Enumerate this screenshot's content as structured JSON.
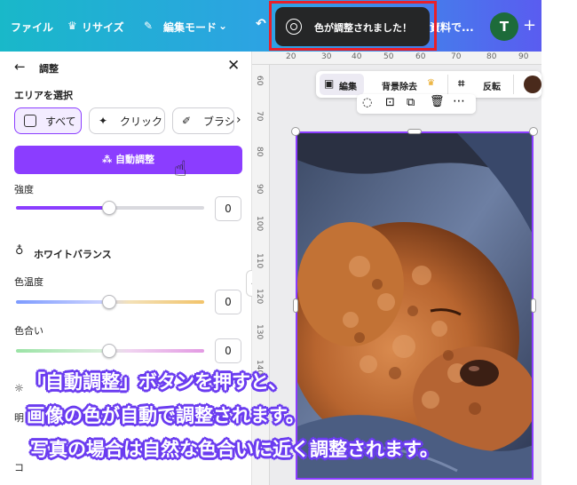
{
  "topbar": {
    "file_label": "ファイル",
    "resize_label": "リサイズ",
    "edit_mode_label": "編集モード",
    "presentation_partial": "資料で...",
    "avatar_initial": "T"
  },
  "toast": {
    "message": "色が調整されました！"
  },
  "panel": {
    "title": "調整",
    "area_heading": "エリアを選択",
    "chips": [
      "すべて",
      "クリック",
      "ブラシ"
    ],
    "auto_button": "自動調整",
    "sliders": [
      {
        "label": "強度",
        "value": "0",
        "level": 0.5
      },
      {
        "label": "色温度",
        "value": "0",
        "level": 0.5
      },
      {
        "label": "色合い",
        "value": "0",
        "level": 0.5
      }
    ],
    "wb_heading": "ホワイトバランス",
    "partial_label_1": "明",
    "partial_label_2": "コ"
  },
  "toolbar": {
    "edit_label": "編集",
    "bg_remove_label": "背景除去",
    "flip_label": "反転"
  },
  "rulers": {
    "top": [
      "20",
      "30",
      "40",
      "50",
      "60",
      "70",
      "80",
      "90"
    ],
    "left": [
      "60",
      "70",
      "80",
      "90",
      "100",
      "110",
      "120",
      "130",
      "140"
    ]
  },
  "captions": [
    "「自動調整」ボタンを押すと、",
    "画像の色が自動で調整されます。",
    "写真の場合は自然な色合いに近く調整されます。"
  ],
  "colors": {
    "accent": "#8b3dff",
    "highlight": "#e8202a",
    "caption_outline": "#6b3cf0"
  }
}
